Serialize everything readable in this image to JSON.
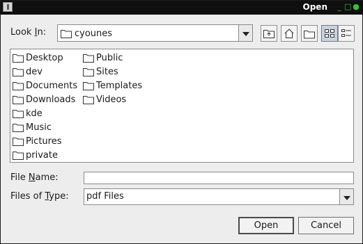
{
  "window": {
    "title": "Open",
    "controls": {
      "minimize": "_",
      "maximize": "□",
      "close": "●"
    }
  },
  "look_in": {
    "label_prefix": "Look ",
    "label_mnemonic": "I",
    "label_suffix": "n:",
    "value": "cyounes"
  },
  "toolbar": {
    "buttons": [
      "up-one-level-icon",
      "home-icon",
      "new-folder-icon",
      "list-view-icon",
      "details-view-icon"
    ],
    "active": "list-view-icon"
  },
  "files": {
    "col1": [
      "Desktop",
      "dev",
      "Documents",
      "Downloads",
      "kde",
      "Music",
      "Pictures",
      "private"
    ],
    "col2": [
      "Public",
      "Sites",
      "Templates",
      "Videos"
    ]
  },
  "file_name": {
    "label_prefix": "File ",
    "label_mnemonic": "N",
    "label_suffix": "ame:",
    "value": ""
  },
  "file_type": {
    "label_prefix": "Files of ",
    "label_mnemonic": "T",
    "label_suffix": "ype:",
    "value": "pdf Files"
  },
  "buttons": {
    "open": "Open",
    "cancel": "Cancel"
  },
  "colors": {
    "titlebar": "#0f0f0f",
    "dialog": "#ededed",
    "window_controls": "#36c236"
  }
}
